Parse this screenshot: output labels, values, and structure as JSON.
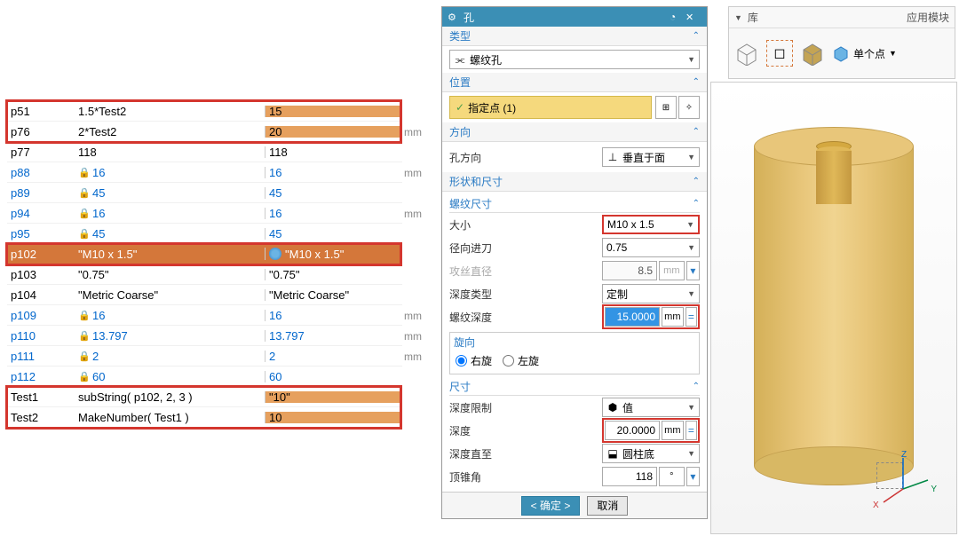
{
  "table": {
    "rows": [
      {
        "name": "p51",
        "expr": "1.5*Test2",
        "val": "15",
        "hi": true,
        "lock": false,
        "blue": false,
        "mm": ""
      },
      {
        "name": "p76",
        "expr": "2*Test2",
        "val": "20",
        "hi": true,
        "lock": false,
        "blue": false,
        "mm": "mm"
      },
      {
        "name": "p77",
        "expr": "118",
        "val": "118",
        "hi": false,
        "lock": false,
        "blue": false,
        "mm": ""
      },
      {
        "name": "p88",
        "expr": "16",
        "val": "16",
        "hi": false,
        "lock": true,
        "blue": true,
        "mm": "mm"
      },
      {
        "name": "p89",
        "expr": "45",
        "val": "45",
        "hi": false,
        "lock": true,
        "blue": true,
        "mm": ""
      },
      {
        "name": "p94",
        "expr": "16",
        "val": "16",
        "hi": false,
        "lock": true,
        "blue": true,
        "mm": "mm"
      },
      {
        "name": "p95",
        "expr": "45",
        "val": "45",
        "hi": false,
        "lock": true,
        "blue": true,
        "mm": ""
      },
      {
        "name": "p102",
        "expr": "\"M10 x 1.5\"",
        "val": "\"M10 x 1.5\"",
        "sel": true,
        "lock": false,
        "blue": false,
        "mm": "",
        "blob": true
      },
      {
        "name": "p103",
        "expr": "\"0.75\"",
        "val": "\"0.75\"",
        "hi": false,
        "lock": false,
        "blue": false,
        "mm": ""
      },
      {
        "name": "p104",
        "expr": "\"Metric Coarse\"",
        "val": "\"Metric Coarse\"",
        "hi": false,
        "lock": false,
        "blue": false,
        "mm": ""
      },
      {
        "name": "p109",
        "expr": "16",
        "val": "16",
        "hi": false,
        "lock": true,
        "blue": true,
        "mm": "mm"
      },
      {
        "name": "p110",
        "expr": "13.797",
        "val": "13.797",
        "hi": false,
        "lock": true,
        "blue": true,
        "mm": "mm"
      },
      {
        "name": "p111",
        "expr": "2",
        "val": "2",
        "hi": false,
        "lock": true,
        "blue": true,
        "mm": "mm"
      },
      {
        "name": "p112",
        "expr": "60",
        "val": "60",
        "hi": false,
        "lock": true,
        "blue": true,
        "mm": ""
      },
      {
        "name": "Test1",
        "expr": "subString( p102, 2, 3 )",
        "val": "\"10\"",
        "hi": true,
        "lock": false,
        "blue": false,
        "mm": ""
      },
      {
        "name": "Test2",
        "expr": "MakeNumber( Test1 )",
        "val": "10",
        "hi": true,
        "lock": false,
        "blue": false,
        "mm": ""
      }
    ]
  },
  "dialog": {
    "title": "孔",
    "sec_type": "类型",
    "type_value": "螺纹孔",
    "sec_pos": "位置",
    "pos_btn": "指定点 (1)",
    "sec_dir": "方向",
    "dir_label": "孔方向",
    "dir_value": "垂直于面",
    "sec_shape": "形状和尺寸",
    "sub_thread": "螺纹尺寸",
    "size_lbl": "大小",
    "size_val": "M10 x 1.5",
    "radial_lbl": "径向进刀",
    "radial_val": "0.75",
    "tapdia_lbl": "攻丝直径",
    "tapdia_val": "8.5",
    "tapdia_unit": "mm",
    "depthtype_lbl": "深度类型",
    "depthtype_val": "定制",
    "threaddepth_lbl": "螺纹深度",
    "threaddepth_val": "15.0000",
    "threaddepth_unit": "mm",
    "rotation_lbl": "旋向",
    "rot_right": "右旋",
    "rot_left": "左旋",
    "sub_dim": "尺寸",
    "depthlimit_lbl": "深度限制",
    "depthlimit_val": "值",
    "depth_lbl": "深度",
    "depth_val": "20.0000",
    "depth_unit": "mm",
    "depthto_lbl": "深度直至",
    "depthto_val": "圆柱底",
    "cone_lbl": "顶锥角",
    "cone_val": "118",
    "cone_unit": "°",
    "ok": "确定",
    "cancel": "取消"
  },
  "toolbar": {
    "lib": "库",
    "app": "应用模块",
    "single": "单个点"
  },
  "axes": {
    "x": "X",
    "y": "Y",
    "z": "Z"
  }
}
